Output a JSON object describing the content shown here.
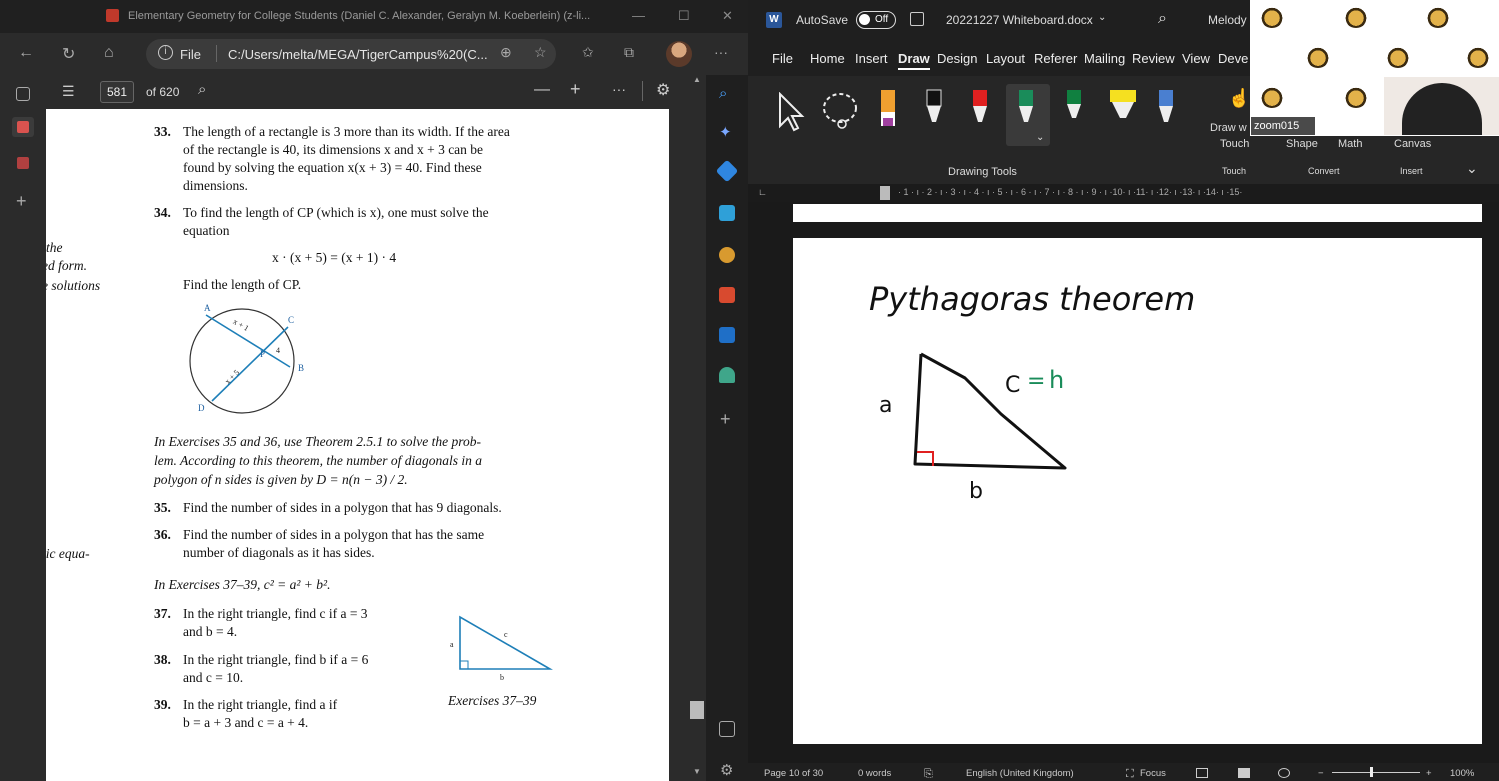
{
  "edge": {
    "window_title": "Elementary Geometry for College Students (Daniel C. Alexander, Geralyn M. Koeberlein) (z-li...",
    "file_label": "File",
    "url": "C:/Users/melta/MEGA/TigerCampus%20(C...",
    "page_number": "581",
    "page_total": "of 620"
  },
  "book": {
    "margin_notes": [
      "the",
      "ed form.",
      "e solutions",
      "tic equa-"
    ],
    "ex33": {
      "num": "33.",
      "lines": [
        "The length of a rectangle is 3 more than its width. If the area",
        "of the rectangle is 40, its dimensions x and x + 3 can be",
        "found by solving the equation x(x + 3) = 40. Find these",
        "dimensions."
      ]
    },
    "ex34": {
      "num": "34.",
      "line1": "To find the length of CP (which is x), one must solve the",
      "line2": "equation",
      "equation": "x · (x + 5) = (x + 1) · 4",
      "line3": "Find the length of CP."
    },
    "circle_labels": {
      "a": "A",
      "b": "B",
      "c": "C",
      "d": "D",
      "p": "P",
      "seg1": "x + 1",
      "seg2": "4",
      "seg3": "x + 5"
    },
    "intro_35_36": [
      "In Exercises 35 and 36, use Theorem 2.5.1 to solve the prob-",
      "lem. According to this theorem, the number of diagonals in a",
      "polygon of n sides is given by D = n(n − 3) / 2."
    ],
    "ex35": {
      "num": "35.",
      "text": "Find the number of sides in a polygon that has 9 diagonals."
    },
    "ex36": {
      "num": "36.",
      "line1": "Find the number of sides in a polygon that has the same",
      "line2": "number of diagonals as it has sides."
    },
    "intro_37_39": "In Exercises 37–39, c² = a² + b².",
    "ex37": {
      "num": "37.",
      "line1": "In the right triangle, find c if a = 3",
      "line2": "and b = 4."
    },
    "ex38": {
      "num": "38.",
      "line1": "In the right triangle, find b if a = 6",
      "line2": "and c = 10."
    },
    "ex39": {
      "num": "39.",
      "line1": "In the right triangle, find a if",
      "line2": "b = a + 3 and c = a + 4."
    },
    "figure_caption": "Exercises 37–39",
    "tri_labels": {
      "a": "a",
      "b": "b",
      "c": "c"
    }
  },
  "word": {
    "autosave": "AutoSave",
    "toggle": "Off",
    "doc_title": "20221227 Whiteboard.docx",
    "user": "Melody",
    "menu": [
      "File",
      "Home",
      "Insert",
      "Draw",
      "Design",
      "Layout",
      "Referer",
      "Mailing",
      "Review",
      "View",
      "Deve"
    ],
    "active_menu": "Draw",
    "ribbon": {
      "drawing_tools": "Drawing Tools",
      "draw_with_touch": "Draw w",
      "touch": "Touch",
      "shape": "Shape",
      "math": "Math",
      "canvas": "Canvas",
      "touch_group": "Touch",
      "convert_group": "Convert",
      "insert_group": "Insert"
    },
    "ruler_text": "· 1 · ı · 2 · ı · 3 · ı · 4 · ı · 5 · ı · 6 · ı · 7 · ı · 8 · ı · 9 · ı ·10· ı ·11· ı ·12· ı ·13· ı ·14· ı ·15·",
    "whiteboard": {
      "title": "Pythagoras theorem",
      "label_a": "a",
      "label_b": "b",
      "label_c": "C",
      "equals": "=",
      "label_h": "h"
    },
    "status": {
      "page": "Page 10 of 30",
      "words": "0 words",
      "language": "English (United Kingdom)",
      "focus": "Focus",
      "zoom": "100%"
    }
  },
  "zoom": {
    "participant_label": "zoom015"
  },
  "colors": {
    "ink_green": "#1a8c5a",
    "right_angle": "#e02020",
    "word_blue": "#2b579a"
  }
}
